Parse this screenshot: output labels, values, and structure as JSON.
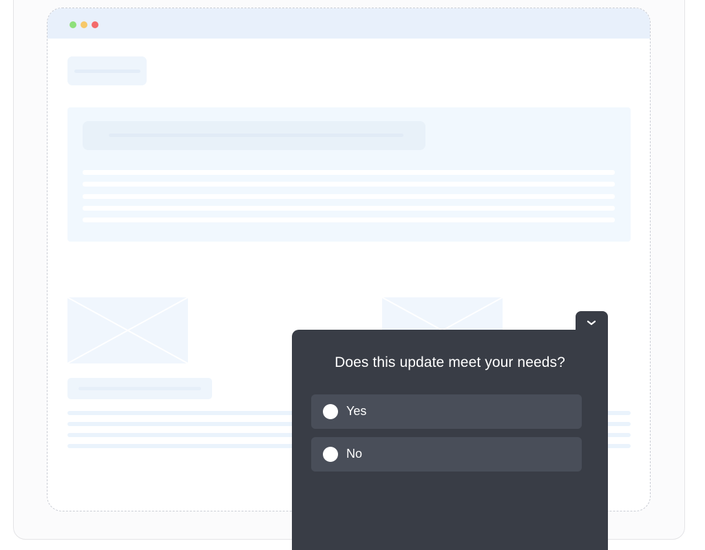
{
  "window": {
    "controls": [
      "green-dot",
      "yellow-dot",
      "red-dot"
    ]
  },
  "survey": {
    "question": "Does this update meet your needs?",
    "options": [
      {
        "label": "Yes"
      },
      {
        "label": "No"
      }
    ],
    "collapse_icon": "chevron-down-icon"
  },
  "colors": {
    "survey_bg": "#393d46",
    "option_bg": "#494e59",
    "browser_bar": "#e8f0fb"
  }
}
